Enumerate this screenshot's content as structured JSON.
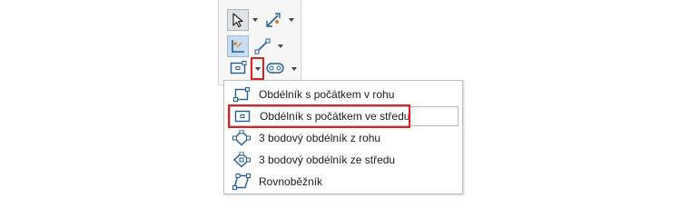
{
  "toolbar": {
    "buttons": [
      {
        "name": "select-pointer",
        "icon": "arrow-pointer-icon",
        "pressed": true
      },
      {
        "name": "smart-dimension",
        "icon": "smart-dimension-icon"
      },
      {
        "name": "sketch",
        "icon": "sketch-icon",
        "pressed": true
      },
      {
        "name": "line",
        "icon": "line-icon"
      },
      {
        "name": "rectangle",
        "icon": "center-rectangle-icon"
      },
      {
        "name": "slot",
        "icon": "slot-icon"
      }
    ]
  },
  "menu": {
    "items": [
      {
        "label": "Obdélník s počátkem v rohu",
        "icon": "corner-rectangle-icon",
        "selected": false
      },
      {
        "label": "Obdélník s počátkem ve středu",
        "icon": "center-rectangle-icon",
        "selected": true
      },
      {
        "label": "3 bodový obdélník z rohu",
        "icon": "3-point-corner-rectangle-icon",
        "selected": false
      },
      {
        "label": "3 bodový obdélník ze středu",
        "icon": "3-point-center-rectangle-icon",
        "selected": false
      },
      {
        "label": "Rovnoběžník",
        "icon": "parallelogram-icon",
        "selected": false
      }
    ]
  },
  "colors": {
    "highlight": "#e02020",
    "icon_blue": "#1f5e96",
    "pressed_bg": "#c9ddf2"
  }
}
